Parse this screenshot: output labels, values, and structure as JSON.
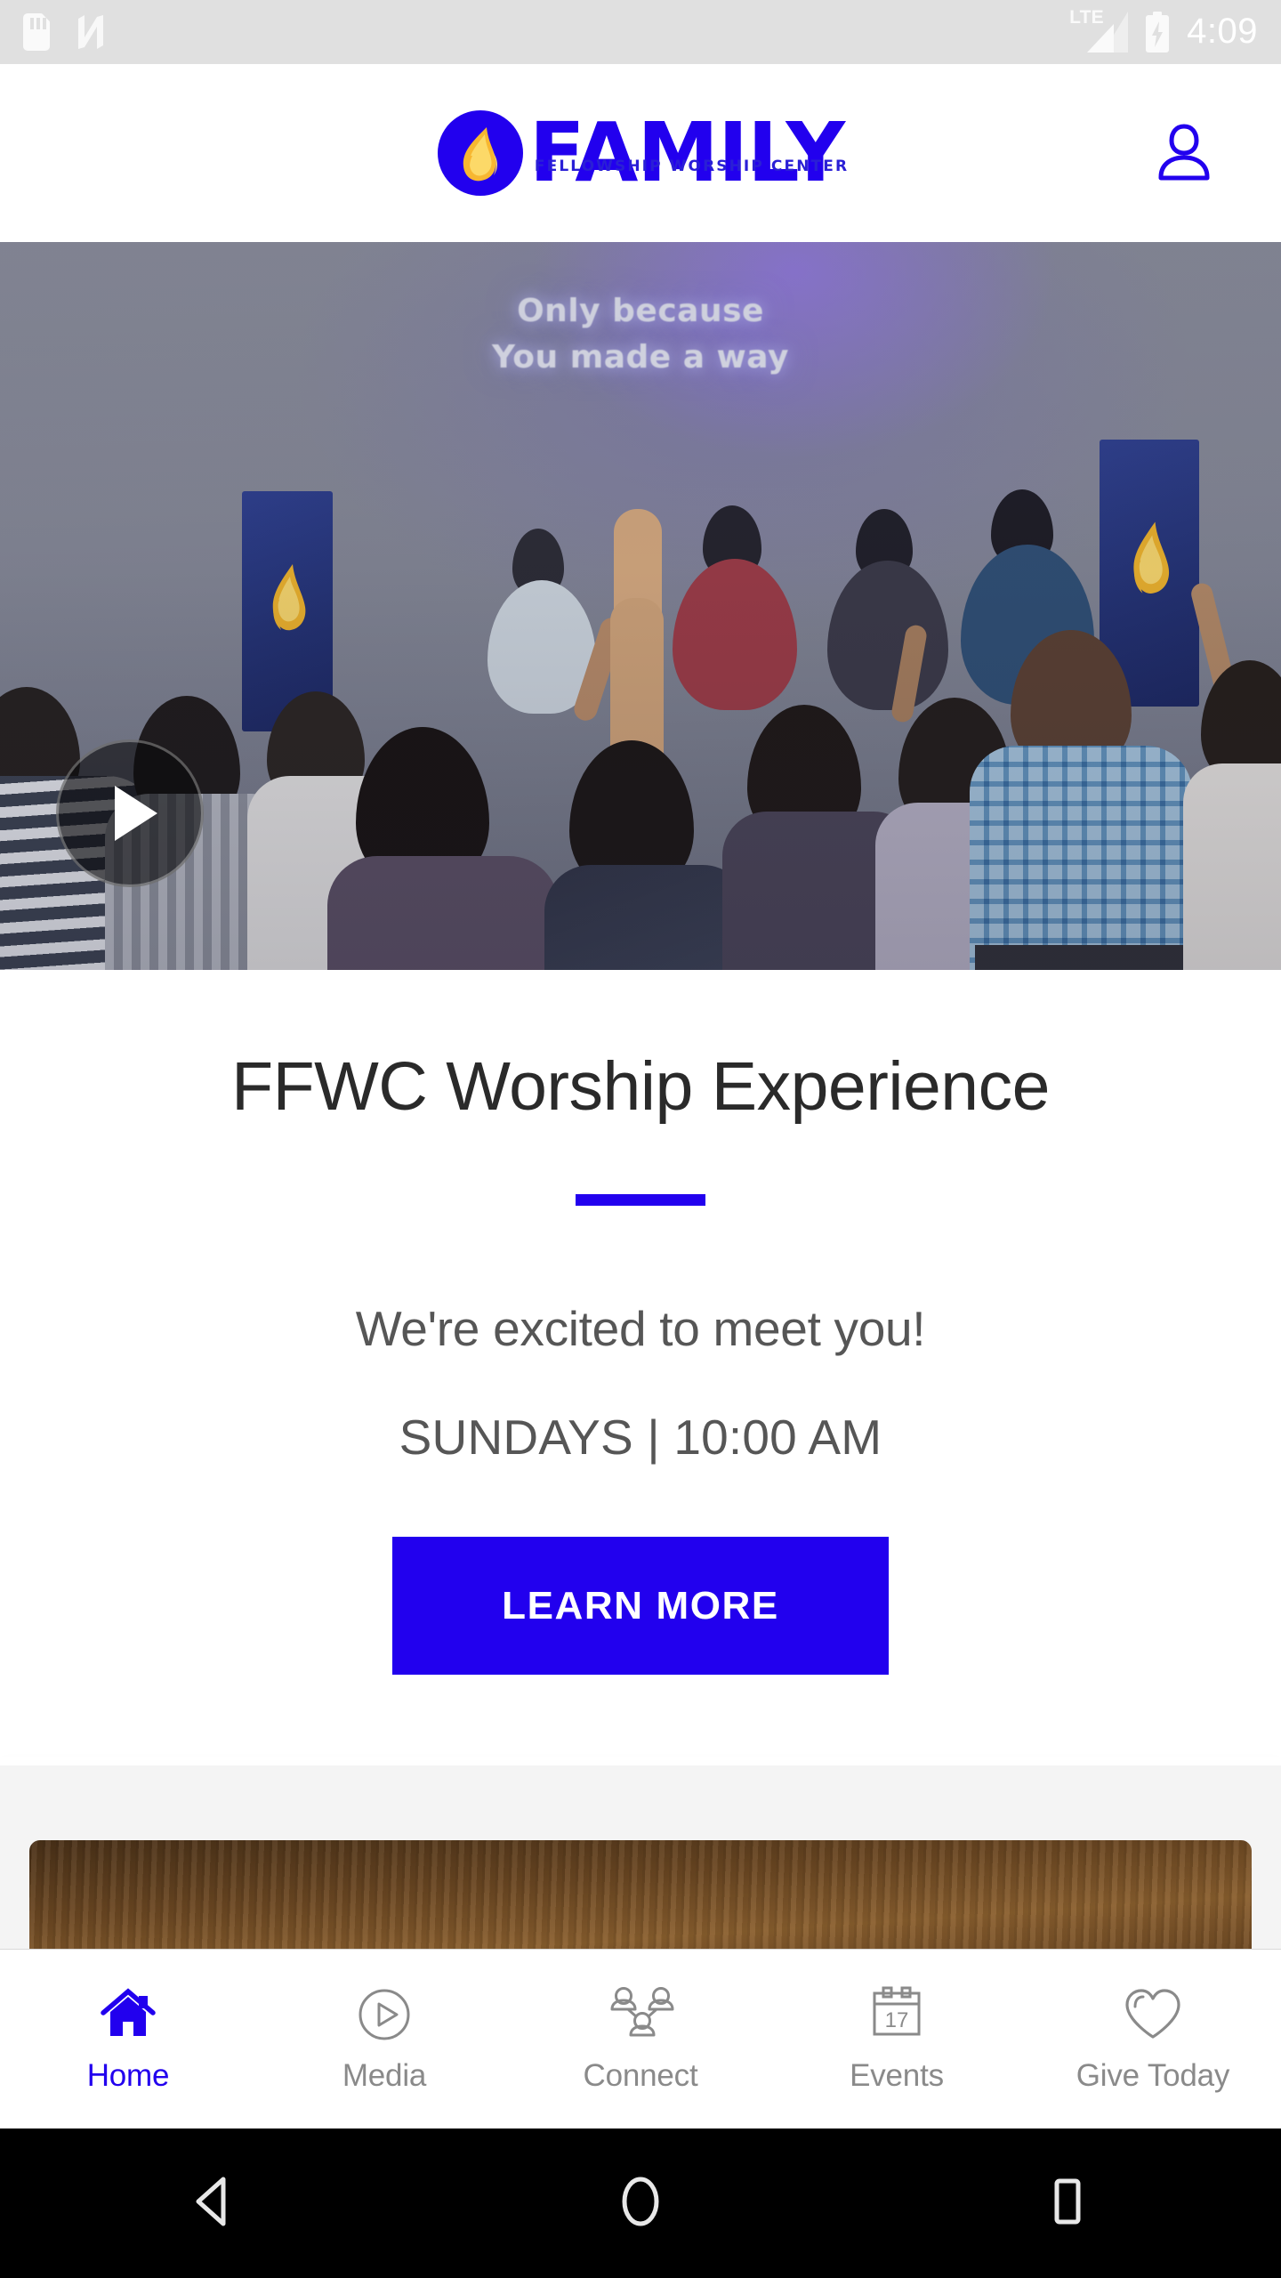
{
  "status_bar": {
    "time": "4:09",
    "network_label": "LTE",
    "icons": [
      "sd-card-icon",
      "android-nougat-icon",
      "lte-signal-icon",
      "battery-charging-icon"
    ],
    "background": "#e0e0e0",
    "text_color": "#ffffff"
  },
  "header": {
    "logo_primary": "FAMILY",
    "logo_secondary": "FELLOWSHIP WORSHIP CENTER",
    "logo_mark": "flame-in-circle-icon",
    "profile_icon": "profile-person-icon",
    "brand_color": "#2200ee",
    "flame_colors": [
      "#f7c948",
      "#f59e0b",
      "#fde68a"
    ]
  },
  "hero": {
    "lyric_line_1": "Only because",
    "lyric_line_2": "You made a way",
    "play_button_icon": "play-triangle-icon",
    "alt": "Congregation worshipping with hands raised in sanctuary"
  },
  "main": {
    "headline": "FFWC Worship Experience",
    "divider_color": "#2200ee",
    "lead": "We're excited to meet you!",
    "service_times": "SUNDAYS | 10:00 AM",
    "cta_label": "LEARN MORE",
    "cta_background": "#2200ee",
    "cta_text_color": "#ffffff"
  },
  "next_section": {
    "card_alt": "wood-grain-background-card"
  },
  "tabbar": {
    "active_color": "#2200ee",
    "inactive_color": "#8a8a8a",
    "items": [
      {
        "label": "Home",
        "icon": "home-icon",
        "active": true
      },
      {
        "label": "Media",
        "icon": "circle-play-icon",
        "active": false
      },
      {
        "label": "Connect",
        "icon": "people-network-icon",
        "active": false
      },
      {
        "label": "Events",
        "icon": "calendar-icon",
        "active": false,
        "badge": "17"
      },
      {
        "label": "Give Today",
        "icon": "heart-icon",
        "active": false
      }
    ]
  },
  "android_nav": {
    "back": "back-triangle-icon",
    "home": "home-circle-icon",
    "recents": "recents-square-icon"
  }
}
